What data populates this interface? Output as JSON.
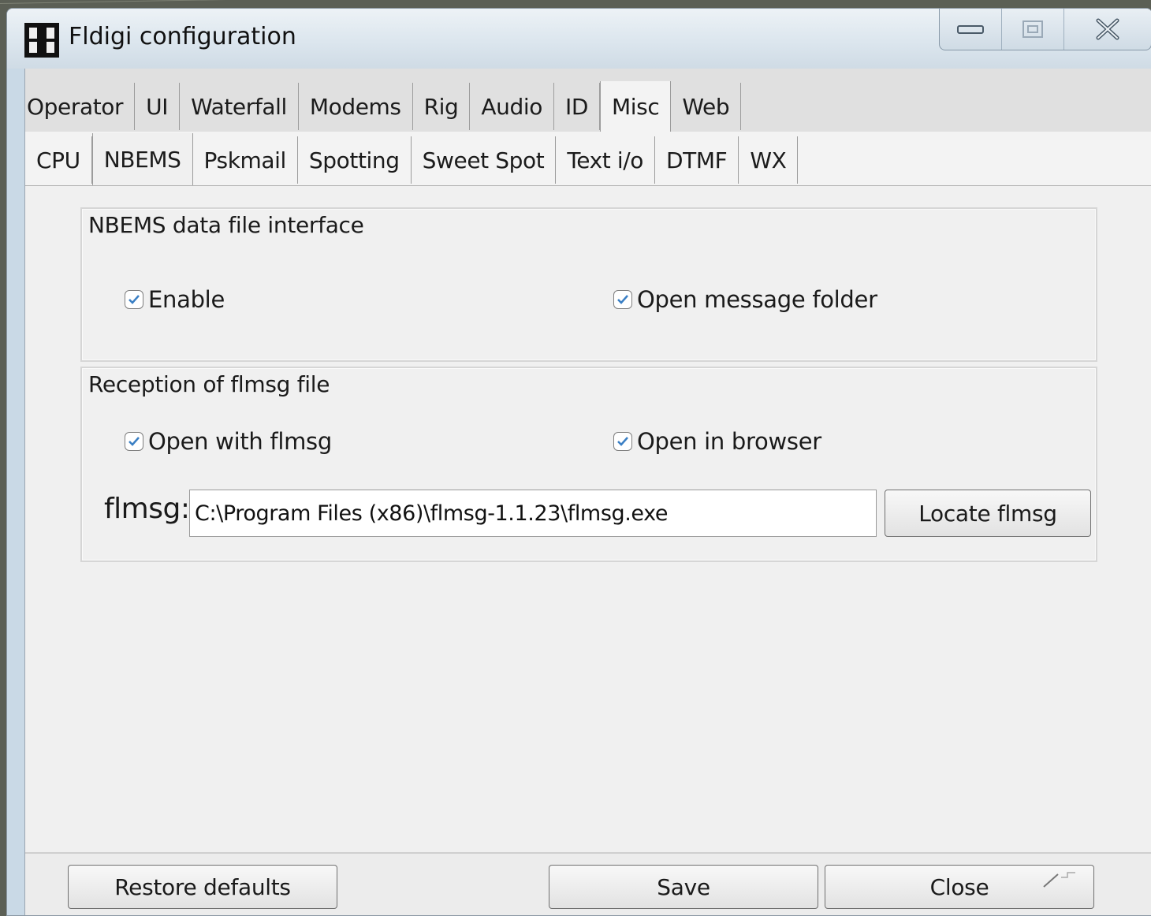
{
  "window": {
    "title": "Fldigi configuration",
    "controls": [
      "minimize-icon",
      "maximize-icon",
      "close-icon"
    ]
  },
  "tabs_primary": [
    {
      "label": "Operator",
      "active": false
    },
    {
      "label": "UI",
      "active": false
    },
    {
      "label": "Waterfall",
      "active": false
    },
    {
      "label": "Modems",
      "active": false
    },
    {
      "label": "Rig",
      "active": false
    },
    {
      "label": "Audio",
      "active": false
    },
    {
      "label": "ID",
      "active": false
    },
    {
      "label": "Misc",
      "active": true
    },
    {
      "label": "Web",
      "active": false
    }
  ],
  "tabs_secondary": [
    {
      "label": "CPU",
      "active": false
    },
    {
      "label": "NBEMS",
      "active": true
    },
    {
      "label": "Pskmail",
      "active": false
    },
    {
      "label": "Spotting",
      "active": false
    },
    {
      "label": "Sweet Spot",
      "active": false
    },
    {
      "label": "Text i/o",
      "active": false
    },
    {
      "label": "DTMF",
      "active": false
    },
    {
      "label": "WX",
      "active": false
    }
  ],
  "nbems_group": {
    "label": "NBEMS data file interface",
    "enable": {
      "label": "Enable",
      "checked": true
    },
    "open_folder": {
      "label": "Open message folder",
      "checked": true
    }
  },
  "reception_group": {
    "label": "Reception of flmsg file",
    "open_with_flmsg": {
      "label": "Open with flmsg",
      "checked": true
    },
    "open_in_browser": {
      "label": "Open in browser",
      "checked": true
    },
    "flmsg_label": "flmsg:",
    "flmsg_path": "C:\\Program Files (x86)\\flmsg-1.1.23\\flmsg.exe",
    "locate_button": "Locate flmsg"
  },
  "footer": {
    "restore_defaults": "Restore defaults",
    "save": "Save",
    "close": "Close"
  },
  "colors": {
    "window_frame": "#c9d9e6",
    "client_bg": "#f0f0f0",
    "check_accent": "#3a7fc4"
  }
}
